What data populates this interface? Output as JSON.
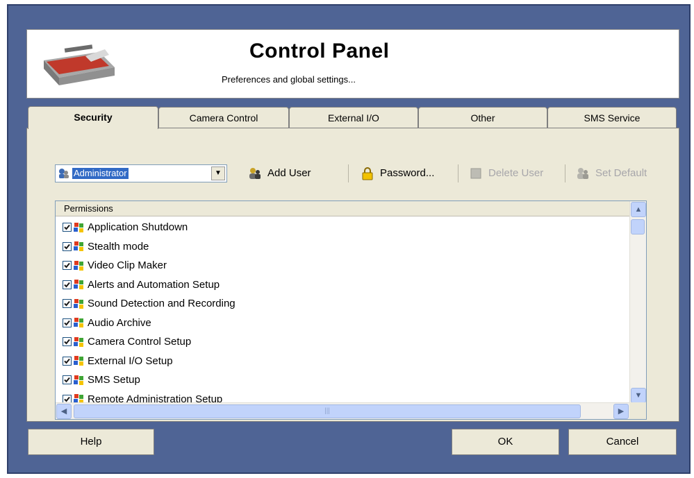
{
  "header": {
    "title": "Control Panel",
    "subtitle": "Preferences and global settings..."
  },
  "tabs": [
    {
      "label": "Security",
      "active": true
    },
    {
      "label": "Camera Control",
      "active": false
    },
    {
      "label": "External I/O",
      "active": false
    },
    {
      "label": "Other",
      "active": false
    },
    {
      "label": "SMS Service",
      "active": false
    }
  ],
  "toolbar": {
    "user_select_value": "Administrator",
    "add_user_label": "Add User",
    "password_label": "Password...",
    "delete_user_label": "Delete User",
    "set_default_label": "Set Default"
  },
  "permissions": {
    "header": "Permissions",
    "items": [
      {
        "label": "Application Shutdown",
        "checked": true
      },
      {
        "label": "Stealth mode",
        "checked": true
      },
      {
        "label": "Video Clip Maker",
        "checked": true
      },
      {
        "label": "Alerts and Automation Setup",
        "checked": true
      },
      {
        "label": "Sound Detection and Recording",
        "checked": true
      },
      {
        "label": "Audio Archive",
        "checked": true
      },
      {
        "label": "Camera Control Setup",
        "checked": true
      },
      {
        "label": "External I/O Setup",
        "checked": true
      },
      {
        "label": "SMS Setup",
        "checked": true
      },
      {
        "label": "Remote Administration Setup",
        "checked": true
      }
    ]
  },
  "buttons": {
    "help": "Help",
    "ok": "OK",
    "cancel": "Cancel"
  },
  "colors": {
    "frame": "#4f6495",
    "dialog_bg": "#ece9d8",
    "selection": "#316ac5",
    "scrollbar": "#c1d3fb"
  }
}
